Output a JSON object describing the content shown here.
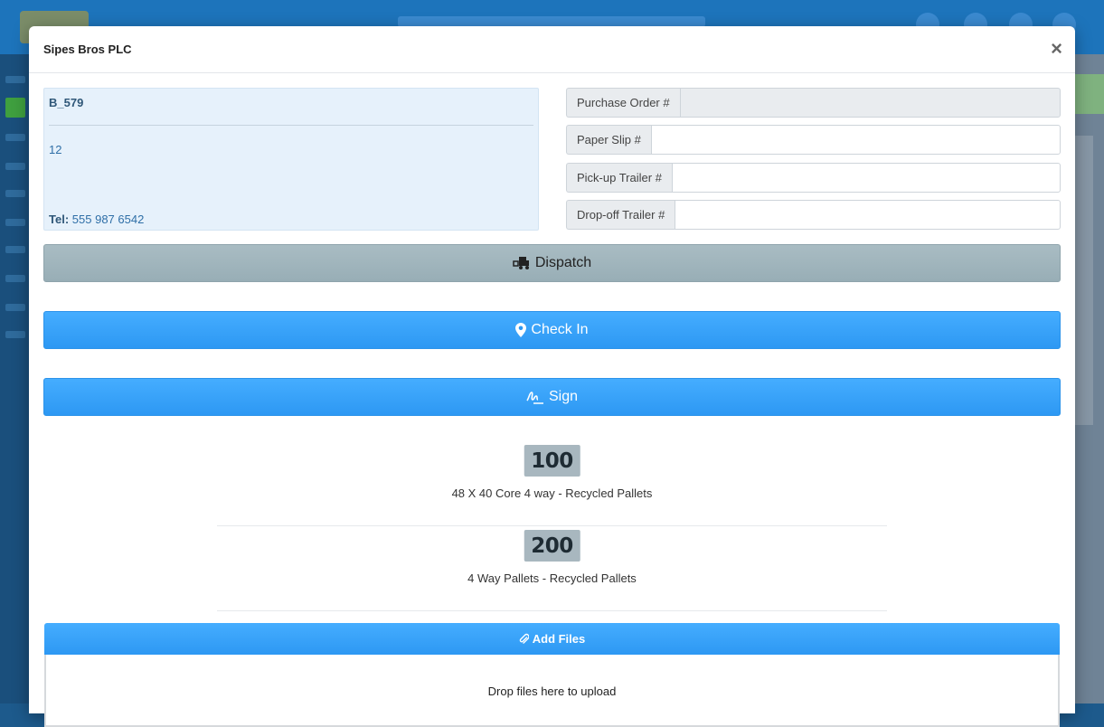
{
  "modal": {
    "title": "Sipes Bros PLC",
    "close_label": "×"
  },
  "info": {
    "code": "B_579",
    "line": "12",
    "tel_label": "Tel:",
    "tel_value": "555 987 6542"
  },
  "fields": {
    "purchase_order": {
      "label": "Purchase Order #",
      "value": "",
      "disabled": true
    },
    "paper_slip": {
      "label": "Paper Slip #",
      "value": ""
    },
    "pickup_trailer": {
      "label": "Pick-up Trailer #",
      "value": ""
    },
    "dropoff_trailer": {
      "label": "Drop-off Trailer #",
      "value": ""
    }
  },
  "buttons": {
    "dispatch_label": "Dispatch",
    "dispatch_icon": "truck-loading-icon",
    "checkin_label": "Check In",
    "checkin_icon": "map-marker-icon",
    "sign_label": "Sign",
    "sign_icon": "signature-icon"
  },
  "items": [
    {
      "qty": "100",
      "name": "48 X 40 Core 4 way - Recycled Pallets"
    },
    {
      "qty": "200",
      "name": "4 Way Pallets - Recycled Pallets"
    }
  ],
  "files": {
    "add_label": "Add Files",
    "add_icon": "paperclip-icon",
    "drop_text": "Drop files here to upload"
  },
  "colors": {
    "primary": "#2d98f3",
    "dispatch": "#a2b6bd",
    "badge": "#a8b7bf",
    "info_bg": "#e6f1fb"
  }
}
